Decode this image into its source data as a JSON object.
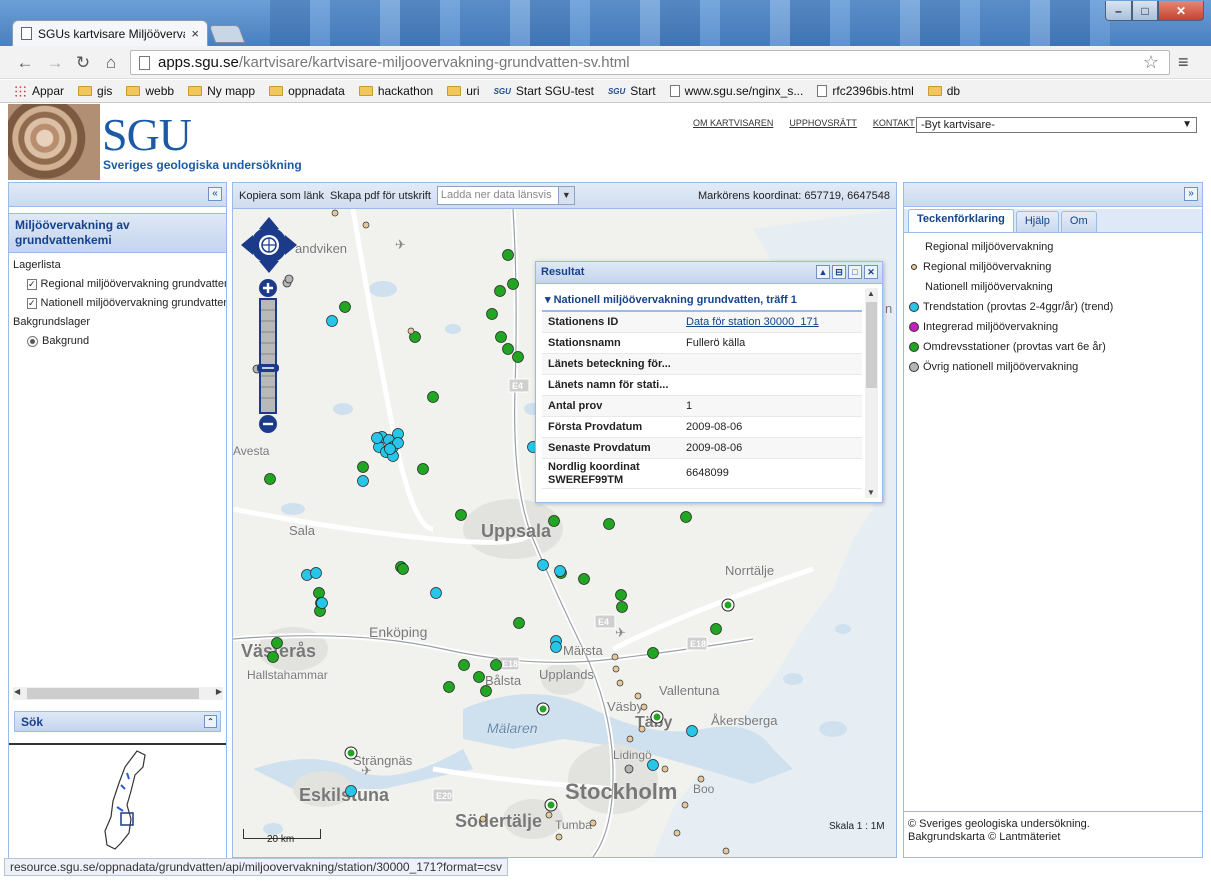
{
  "browser": {
    "tab_title": "SGUs kartvisare Miljöövervakning grundvattenkemi",
    "tab_close": "×",
    "url_host": "apps.sgu.se",
    "url_path": "/kartvisare/kartvisare-miljoovervakning-grundvatten-sv.html",
    "bookmarks": [
      {
        "label": "Appar",
        "icon": "apps-icon"
      },
      {
        "label": "gis",
        "icon": "folder-icon"
      },
      {
        "label": "webb",
        "icon": "folder-icon"
      },
      {
        "label": "Ny mapp",
        "icon": "folder-icon"
      },
      {
        "label": "oppnadata",
        "icon": "folder-icon"
      },
      {
        "label": "hackathon",
        "icon": "folder-icon"
      },
      {
        "label": "uri",
        "icon": "folder-icon"
      },
      {
        "label": "Start SGU-test",
        "icon": "sgu-icon"
      },
      {
        "label": "Start",
        "icon": "sgu-icon"
      },
      {
        "label": "www.sgu.se/nginx_s...",
        "icon": "page-icon"
      },
      {
        "label": "rfc2396bis.html",
        "icon": "page-icon"
      },
      {
        "label": "db",
        "icon": "folder-icon"
      }
    ],
    "status_url": "resource.sgu.se/oppnadata/grundvatten/api/miljoovervakning/station/30000_171?format=csv"
  },
  "header": {
    "logo_text": "SGU",
    "logo_subtitle": "Sveriges geologiska undersökning",
    "links": [
      "OM KARTVISAREN",
      "UPPHOVSRÄTT",
      "KONTAKT"
    ],
    "kartvisare_select": "-Byt kartvisare-"
  },
  "left_panel": {
    "collapse": "«",
    "title": "Miljöövervakning av grundvattenkemi",
    "layer_list_label": "Lagerlista",
    "layers": [
      {
        "label": "Regional miljöövervakning grundvatten",
        "checked": true
      },
      {
        "label": "Nationell miljöövervakning grundvatten",
        "checked": true
      }
    ],
    "background_label": "Bakgrundslager",
    "background_option": "Bakgrund",
    "search_label": "Sök",
    "search_toggle": "⌃"
  },
  "map_toolbar": {
    "copy_link": "Kopiera som länk",
    "pdf": "Skapa pdf för utskrift",
    "download_placeholder": "Ladda ner data länsvis",
    "coord_label": "Markörens koordinat: 657719, 6647548"
  },
  "map": {
    "places": [
      {
        "name": "andviken",
        "size": 13,
        "bold": false
      },
      {
        "name": "Avesta",
        "size": 12,
        "bold": false
      },
      {
        "name": "Sala",
        "size": 13,
        "bold": false
      },
      {
        "name": "Uppsala",
        "size": 18,
        "bold": true
      },
      {
        "name": "Norrtälje",
        "size": 13,
        "bold": false
      },
      {
        "name": "Västerås",
        "size": 18,
        "bold": true
      },
      {
        "name": "Enköping",
        "size": 14,
        "bold": false
      },
      {
        "name": "Hallstahammar",
        "size": 12,
        "bold": false
      },
      {
        "name": "Märsta",
        "size": 13,
        "bold": false
      },
      {
        "name": "Upplands",
        "size": 13,
        "bold": false
      },
      {
        "name": "Bålsta",
        "size": 13,
        "bold": false
      },
      {
        "name": "Vallentuna",
        "size": 13,
        "bold": false
      },
      {
        "name": "Väsby",
        "size": 13,
        "bold": false
      },
      {
        "name": "Täby",
        "size": 16,
        "bold": true
      },
      {
        "name": "Åkersberga",
        "size": 13,
        "bold": false
      },
      {
        "name": "Mälaren",
        "size": 14,
        "bold": false
      },
      {
        "name": "Lidingö",
        "size": 12,
        "bold": false
      },
      {
        "name": "Strängnäs",
        "size": 13,
        "bold": false
      },
      {
        "name": "Eskilstuna",
        "size": 18,
        "bold": true
      },
      {
        "name": "Stockholm",
        "size": 22,
        "bold": true
      },
      {
        "name": "Boo",
        "size": 12,
        "bold": false
      },
      {
        "name": "Södertälje",
        "size": 18,
        "bold": true
      },
      {
        "name": "Tumba",
        "size": 12,
        "bold": false
      }
    ],
    "roads": [
      "E4",
      "E4",
      "E18",
      "E18",
      "E20"
    ],
    "scale_bar_label": "20 km",
    "scale": "Skala 1 : 1M",
    "edge_letter": "n"
  },
  "result": {
    "title": "Resultat",
    "section": "Nationell miljöövervakning grundvatten, träff 1",
    "rows": [
      {
        "key": "Stationens ID",
        "value": "Data för station 30000_171",
        "link": true
      },
      {
        "key": "Stationsnamn",
        "value": "Fullerö källa"
      },
      {
        "key": "Länets beteckning för...",
        "value": ""
      },
      {
        "key": "Länets namn för stati...",
        "value": ""
      },
      {
        "key": "Antal prov",
        "value": "1"
      },
      {
        "key": "Första Provdatum",
        "value": "2009-08-06"
      },
      {
        "key": "Senaste Provdatum",
        "value": "2009-08-06"
      },
      {
        "key": "Nordlig koordinat SWEREF99TM",
        "value": "6648099"
      }
    ]
  },
  "right_panel": {
    "collapse": "»",
    "tabs": [
      "Teckenförklaring",
      "Hjälp",
      "Om"
    ],
    "legend": [
      {
        "label": "Regional miljöövervakning",
        "dot": "none"
      },
      {
        "label": "Regional miljöövervakning",
        "dot": "#e6c79a",
        "small": true
      },
      {
        "label": "Nationell miljöövervakning",
        "dot": "none"
      },
      {
        "label": "Trendstation (provtas 2-4ggr/år) (trend)",
        "dot": "#27c6e8"
      },
      {
        "label": "Integrerad miljöövervakning",
        "dot": "#c61fbf"
      },
      {
        "label": "Omdrevsstationer (provtas vart 6e år)",
        "dot": "#22a522"
      },
      {
        "label": "Övrig nationell miljöövervakning",
        "dot": "#b5b5b5"
      }
    ],
    "copyright_1": "© Sveriges geologiska undersökning.",
    "copyright_2": "Bakgrundskarta © Lantmäteriet"
  },
  "colors": {
    "trend": "#27c6e8",
    "omdrev": "#22a522",
    "regional": "#e6c79a",
    "ovrig": "#b5b5b5",
    "water": "#cfe0ee",
    "road": "#9aa0a6"
  }
}
